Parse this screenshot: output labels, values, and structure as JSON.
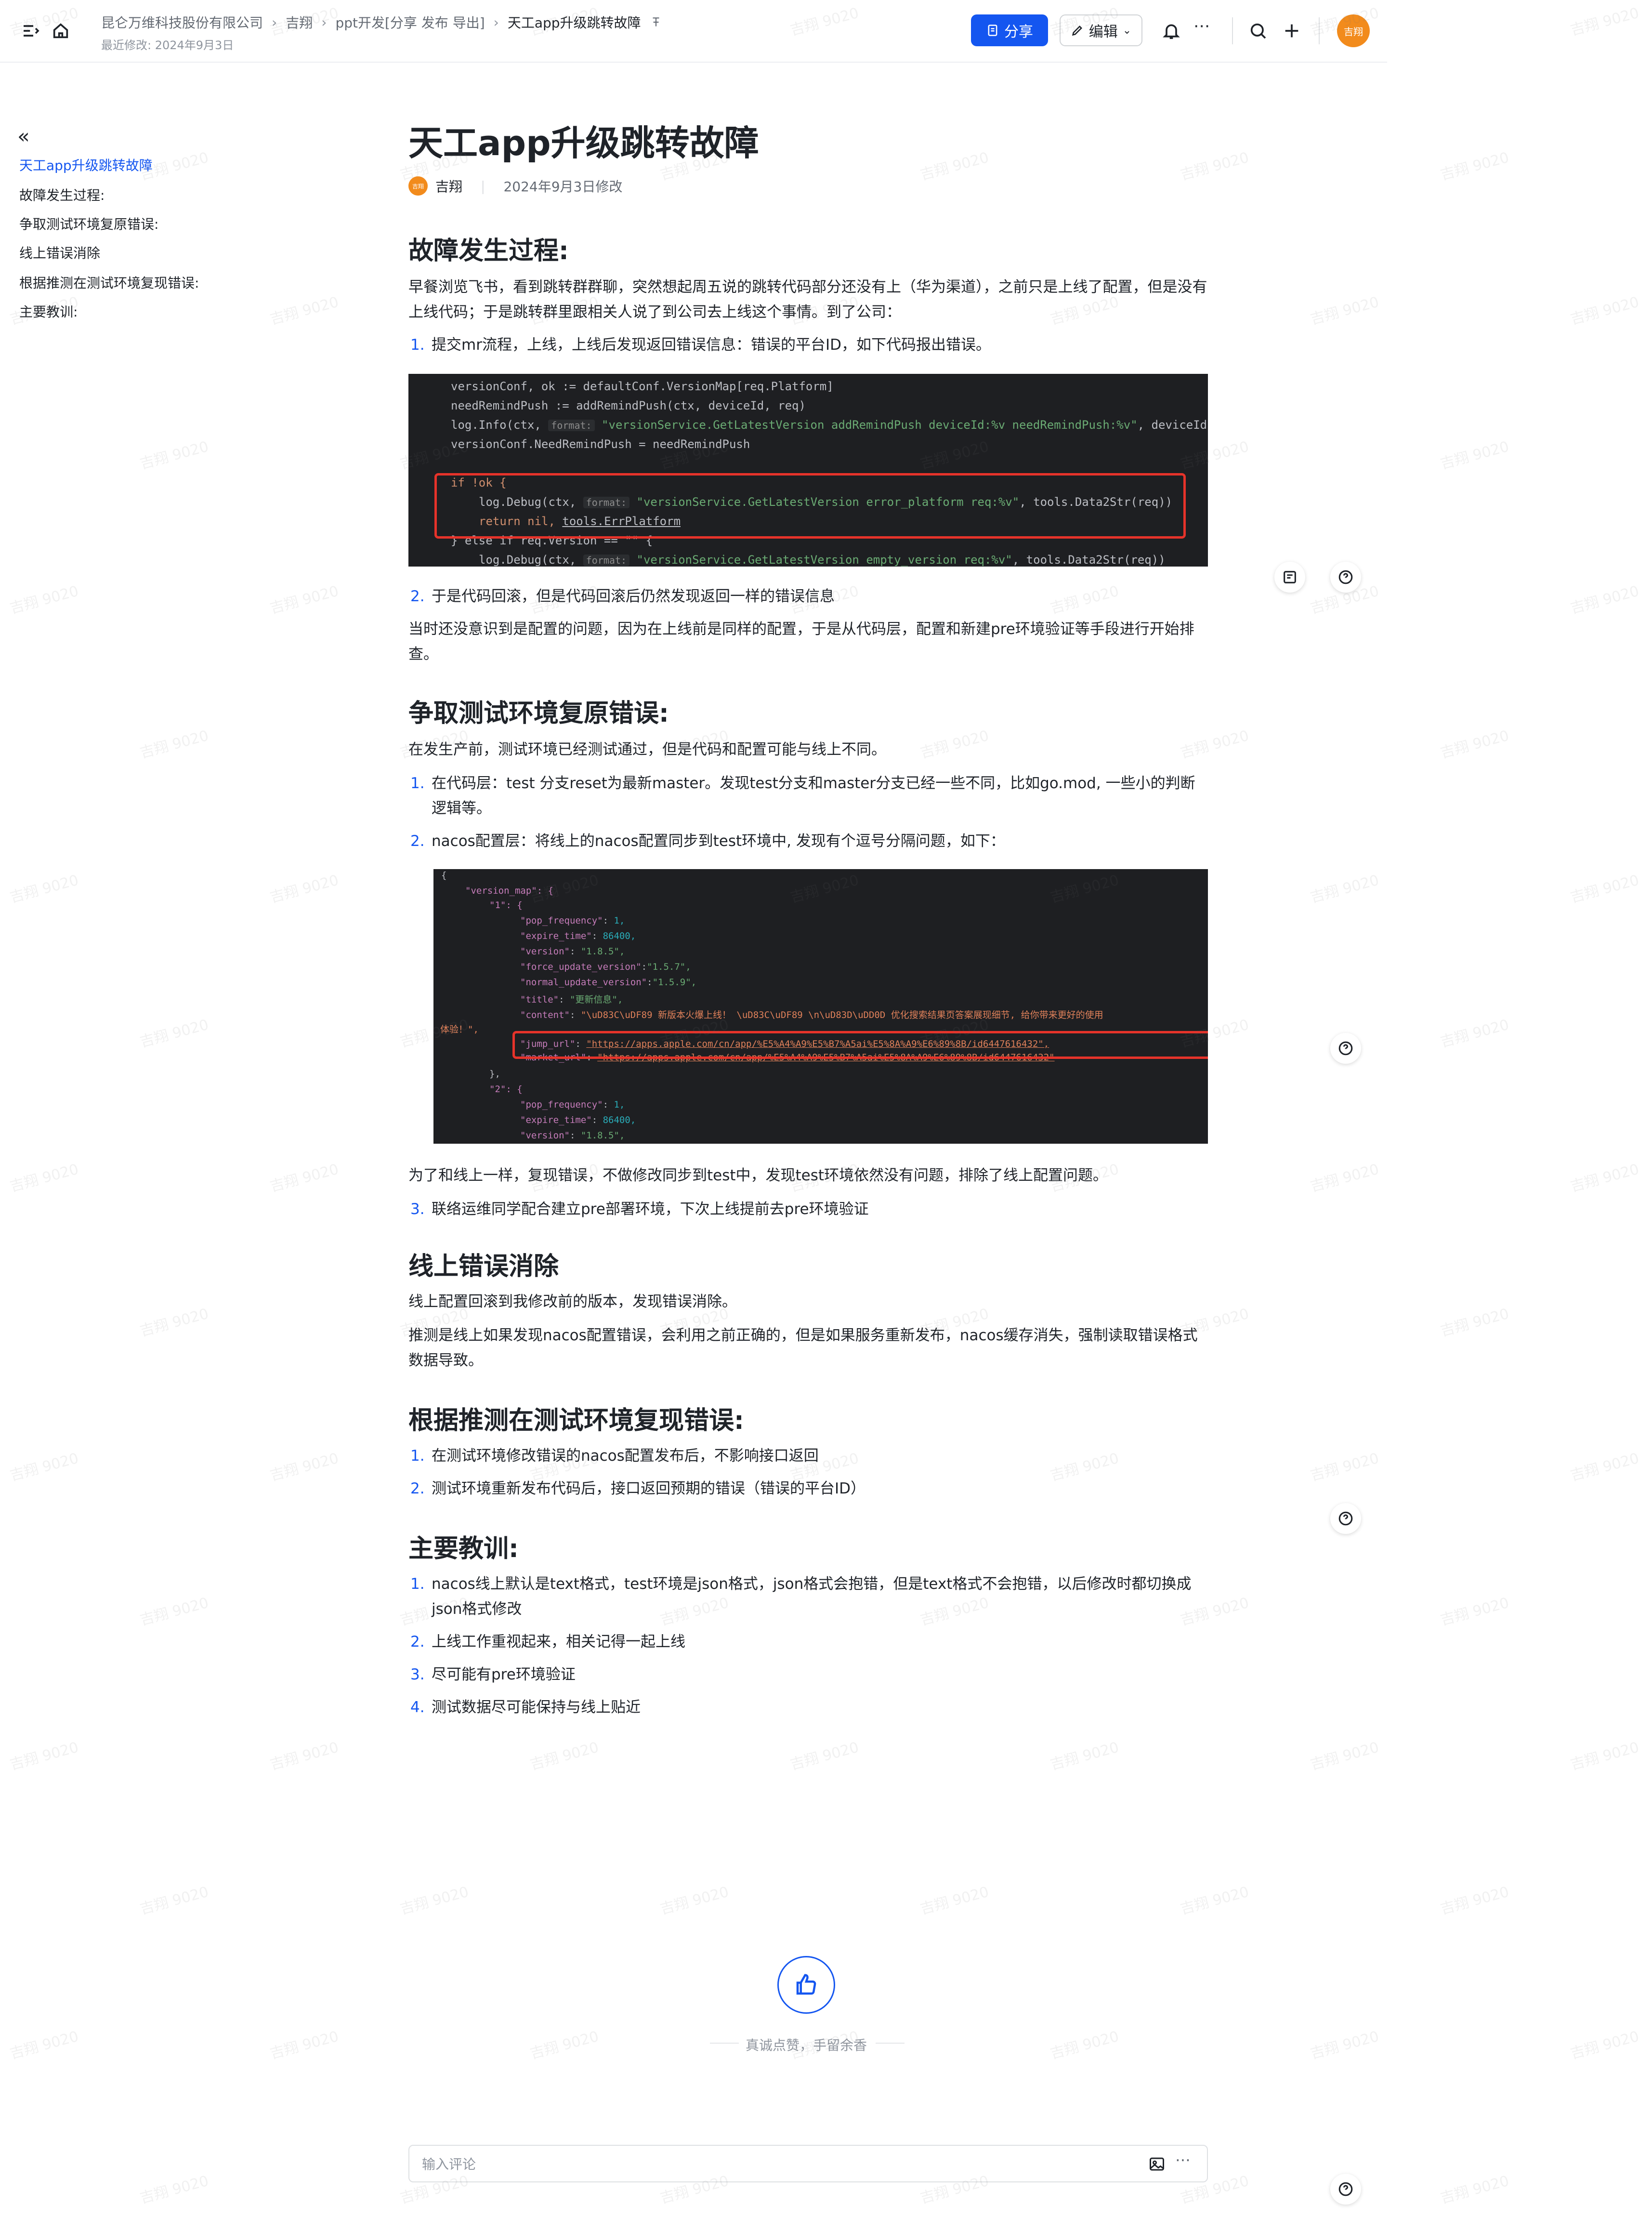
{
  "header": {
    "breadcrumbs": [
      "昆仑万维科技股份有限公司",
      "吉翔",
      "ppt开发[分享 发布 导出]",
      "天工app升级跳转故障"
    ],
    "last_modified": "最近修改: 2024年9月3日",
    "share_label": "分享",
    "edit_label": "编辑",
    "avatar_text": "吉翔",
    "accent_color": "#1456f0"
  },
  "outline": {
    "items": [
      "天工app升级跳转故障",
      "故障发生过程:",
      "争取测试环境复原错误:",
      "线上错误消除",
      "根据推测在测试环境复现错误:",
      "主要教训:"
    ]
  },
  "doc": {
    "title": "天工app升级跳转故障",
    "author_badge": "吉翔",
    "author": "吉翔",
    "modified": "2024年9月3日修改",
    "sections": {
      "s1": {
        "heading": "故障发生过程:",
        "p1": "早餐浏览飞书，看到跳转群群聊，突然想起周五说的跳转代码部分还没有上（华为渠道），之前只是上线了配置，但是没有上线代码；于是跳转群里跟相关人说了到公司去上线这个事情。到了公司：",
        "li1": "提交mr流程，上线，上线后发现返回错误信息：错误的平台ID，如下代码报出错误。",
        "li2": "于是代码回滚，但是代码回滚后仍然发现返回一样的错误信息",
        "p2": "当时还没意识到是配置的问题，因为在上线前是同样的配置，于是从代码层，配置和新建pre环境验证等手段进行开始排查。"
      },
      "s2": {
        "heading": "争取测试环境复原错误:",
        "p1": "在发生产前，测试环境已经测试通过，但是代码和配置可能与线上不同。",
        "li1": "在代码层：test 分支reset为最新master。发现test分支和master分支已经一些不同，比如go.mod, 一些小的判断逻辑等。",
        "li2": "nacos配置层：将线上的nacos配置同步到test环境中, 发现有个逗号分隔问题，如下：",
        "p2": "为了和线上一样，复现错误，不做修改同步到test中，发现test环境依然没有问题，排除了线上配置问题。",
        "li3": "联络运维同学配合建立pre部署环境，下次上线提前去pre环境验证"
      },
      "s3": {
        "heading": "线上错误消除",
        "p1": "线上配置回滚到我修改前的版本，发现错误消除。",
        "p2": "推测是线上如果发现nacos配置错误，会利用之前正确的，但是如果服务重新发布，nacos缓存消失，强制读取错误格式数据导致。"
      },
      "s4": {
        "heading": "根据推测在测试环境复现错误:",
        "li1": "在测试环境修改错误的nacos配置发布后，不影响接口返回",
        "li2": "测试环境重新发布代码后，接口返回预期的错误（错误的平台ID）"
      },
      "s5": {
        "heading": "主要教训:",
        "li1": "nacos线上默认是text格式，test环境是json格式，json格式会抱错，但是text格式不会抱错，以后修改时都切换成json格式修改",
        "li2": "上线工作重视起来，相关记得一起上线",
        "li3": "尽可能有pre环境验证",
        "li4": "测试数据尽可能保持与线上贴近"
      }
    },
    "list_numbers": [
      "1.",
      "2.",
      "3.",
      "4."
    ]
  },
  "code1": {
    "l1": "versionConf, ok := defaultConf.VersionMap[req.Platform]",
    "l2": "needRemindPush := addRemindPush(ctx, deviceId, req)",
    "l3a": "log.Info(ctx, ",
    "l3hint": "format:",
    "l3b": "\"versionService.GetLatestVersion addRemindPush deviceId:%v needRemindPush:%v\"",
    "l3c": ", deviceId,",
    "l4": "versionConf.NeedRemindPush = needRemindPush",
    "l5": "if !ok {",
    "l6a": "log.Debug(ctx, ",
    "l6hint": "format:",
    "l6b": "\"versionService.GetLatestVersion error_platform req:%v\"",
    "l6c": ", tools.Data2Str(req))",
    "l7a": "return nil, ",
    "l7b": "tools.ErrPlatform",
    "l8": "} else if req.Version == \"\" {",
    "l9a": "log.Debug(ctx, ",
    "l9hint": "format:",
    "l9b": "\"versionService.GetLatestVersion empty_version req:%v\"",
    "l9c": ", tools.Data2Str(req))"
  },
  "code2": {
    "l1": "{",
    "l2": "\"version_map\": {",
    "l3": "\"1\": {",
    "l4k": "\"pop_frequency\"",
    "l4v": "1,",
    "l5k": "\"expire_time\"",
    "l5v": "86400,",
    "l6k": "\"version\"",
    "l6v": "\"1.8.5\",",
    "l7k": "\"force_update_version\"",
    "l7v": "\"1.5.7\",",
    "l8k": "\"normal_update_version\"",
    "l8v": "\"1.5.9\",",
    "l9k": "\"title\"",
    "l9v": "\"更新信息\",",
    "l10k": "\"content\"",
    "l10v": "\"\\uD83C\\uDF89 新版本火爆上线！ \\uD83C\\uDF89 \\n\\uD83D\\uDD0D 优化搜索结果页答案展现细节, 给你带来更好的使用",
    "l11": "体验！\",",
    "l12k": "\"jump_url\"",
    "l12v": "\"https://apps.apple.com/cn/app/%E5%A4%A9%E5%B7%A5ai%E5%8A%A9%E6%89%8B/id6447616432\",",
    "l13k": "\"market_url\"",
    "l13v": "\"https://apps.apple.com/cn/app/%E5%A4%A9%E5%B7%A5ai%E5%8A%A9%E6%89%8B/id6447616432\"",
    "l14": "},",
    "l15": "\"2\": {",
    "l16k": "\"pop_frequency\"",
    "l16v": "1,",
    "l17k": "\"expire_time\"",
    "l17v": "86400,",
    "l18k": "\"version\"",
    "l18v": "\"1.8.5\","
  },
  "footer": {
    "like_text": "真诚点赞，手留余香",
    "comment_placeholder": "输入评论"
  },
  "watermark": "吉翔 9020"
}
